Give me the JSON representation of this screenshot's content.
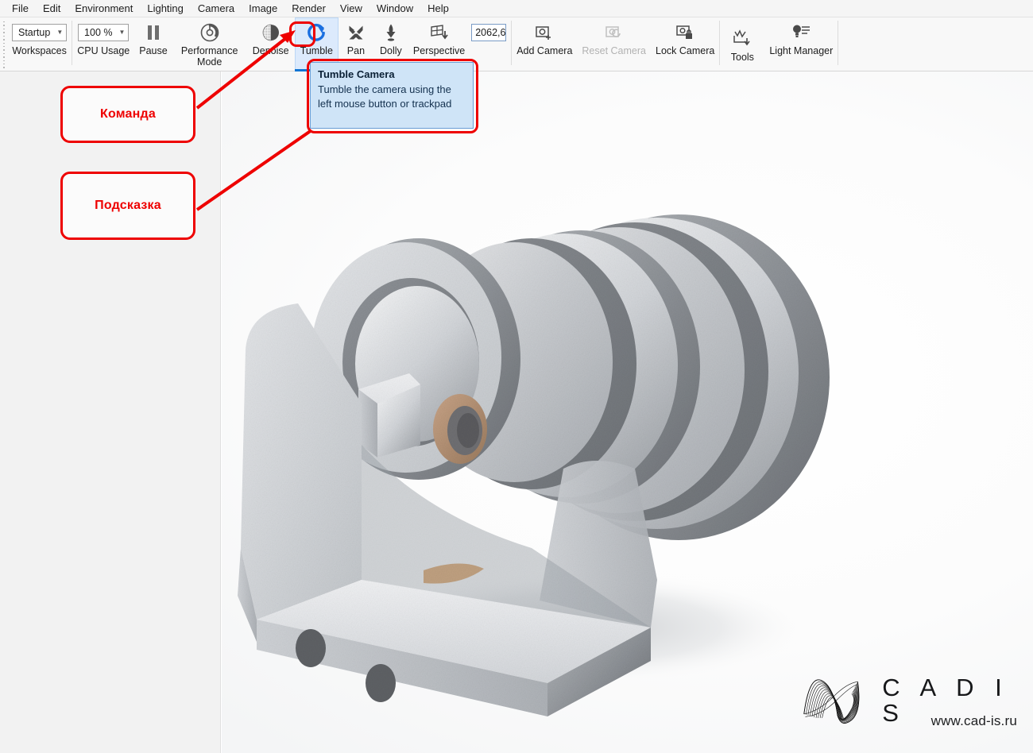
{
  "app": {
    "accent_blue": "#1175d4",
    "annotation_red": "#ee0000",
    "tooltip_bg": "#cfe4f7",
    "toolbar_bg": "#f8f8f8",
    "panel_bg": "#f2f2f2"
  },
  "menubar": {
    "items": [
      {
        "label": "File"
      },
      {
        "label": "Edit"
      },
      {
        "label": "Environment"
      },
      {
        "label": "Lighting"
      },
      {
        "label": "Camera"
      },
      {
        "label": "Image"
      },
      {
        "label": "Render"
      },
      {
        "label": "View"
      },
      {
        "label": "Window"
      },
      {
        "label": "Help"
      }
    ]
  },
  "toolbar": {
    "workspaces": {
      "value": "Startup",
      "caret": "▼",
      "label": "Workspaces",
      "icon": "dropdown-icon"
    },
    "cpu_usage": {
      "value": "100 %",
      "caret": "▼",
      "label": "CPU Usage",
      "icon": "dropdown-icon"
    },
    "pause": {
      "label": "Pause",
      "icon": "pause-icon"
    },
    "performance_mode": {
      "label": "Performance Mode",
      "icon": "performance-icon"
    },
    "denoise": {
      "label": "Denoise",
      "icon": "denoise-icon"
    },
    "tumble": {
      "label": "Tumble",
      "icon": "tumble-icon",
      "state": "active"
    },
    "pan": {
      "label": "Pan",
      "icon": "pan-icon"
    },
    "dolly": {
      "label": "Dolly",
      "icon": "dolly-icon"
    },
    "perspective": {
      "label": "Perspective",
      "icon": "perspective-icon"
    },
    "focal_field": {
      "value": "2062,6",
      "label": "focal-length"
    },
    "add_camera": {
      "label": "Add Camera",
      "icon": "add-camera-icon"
    },
    "reset_camera": {
      "label": "Reset Camera",
      "icon": "reset-camera-icon",
      "state": "disabled"
    },
    "lock_camera": {
      "label": "Lock Camera",
      "icon": "lock-camera-icon"
    },
    "tools": {
      "label": "Tools",
      "icon": "tools-icon"
    },
    "light_manager": {
      "label": "Light Manager",
      "icon": "light-manager-icon"
    }
  },
  "tooltip": {
    "title": "Tumble Camera",
    "body": "Tumble the camera using the left mouse button or trackpad"
  },
  "annotations": {
    "command": {
      "label": "Команда"
    },
    "hint": {
      "label": "Подсказка"
    }
  },
  "viewport": {
    "model_name": "pulley-bracket-assembly",
    "background": "#fefefe"
  },
  "logo": {
    "brand": "C A D I S",
    "url": "www.cad-is.ru",
    "mark": "cadis-ribbon-logo"
  }
}
